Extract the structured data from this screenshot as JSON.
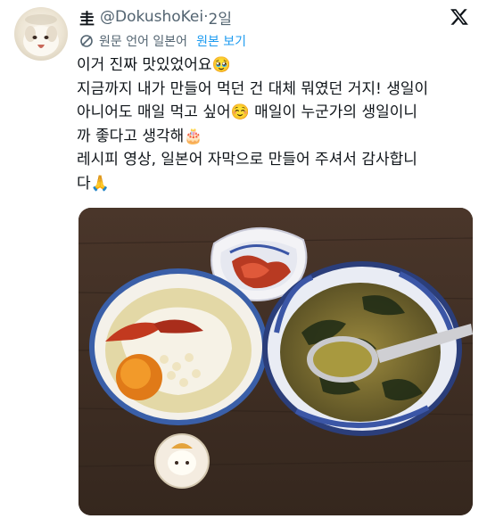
{
  "tweet": {
    "display_name": "圭",
    "handle": "@DokushoKei",
    "separator": "·",
    "time": "2일",
    "translation": {
      "label": "원문 언어 일본어",
      "show_original": "원본 보기"
    },
    "lines": [
      "이거 진짜 맛있었어요🥹",
      "지금까지 내가 만들어 먹던 건 대체 뭐였던 거지! 생일이",
      "아니어도 매일 먹고 싶어☺️ 매일이 누군가의 생일이니",
      "까 좋다고 생각해🎂",
      "레시피 영상, 일본어 자막으로 만들어 주셔서 감사합니",
      "다🙏"
    ]
  },
  "icons": {
    "avatar": "avatar-illustration",
    "logo": "x-logo-icon",
    "translate": "translate-icon"
  },
  "colors": {
    "text": "#0f1419",
    "secondary": "#536471",
    "link": "#1d9bf0"
  }
}
